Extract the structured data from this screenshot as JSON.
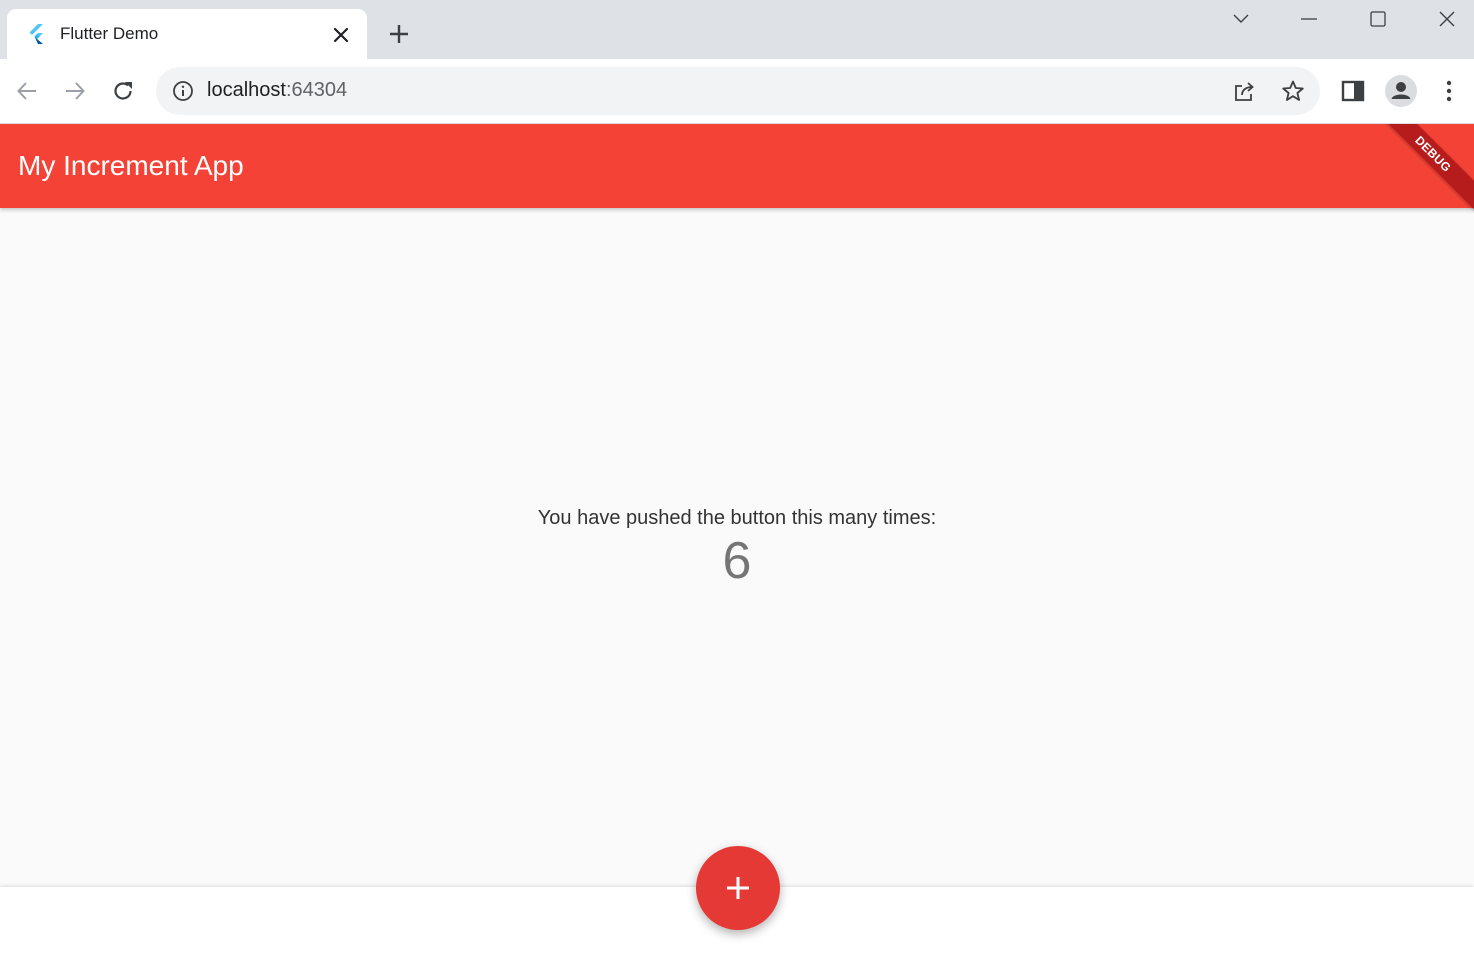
{
  "browser": {
    "tab": {
      "title": "Flutter Demo",
      "favicon": "flutter-logo-icon",
      "close_icon": "close-icon"
    },
    "new_tab_icon": "plus-icon",
    "window_controls": [
      "chevron-down-icon",
      "minimize-icon",
      "maximize-icon",
      "close-icon"
    ],
    "toolbar": {
      "back_icon": "arrow-left-icon",
      "forward_icon": "arrow-right-icon",
      "reload_icon": "reload-icon",
      "address": {
        "host": "localhost",
        "port": ":64304",
        "info_icon": "info-icon"
      },
      "share_icon": "share-icon",
      "bookmark_icon": "star-icon",
      "side_panel_icon": "side-panel-icon",
      "profile_icon": "avatar-icon",
      "menu_icon": "kebab-menu-icon"
    }
  },
  "app": {
    "title": "My Increment App",
    "debug_banner": "DEBUG",
    "message": "You have pushed the button this many times:",
    "counter": "6",
    "fab_icon": "plus-icon",
    "colors": {
      "appbar": "#f44336",
      "fab": "#e53935",
      "debug_banner": "#b71c1c",
      "background": "#fafafa"
    }
  }
}
